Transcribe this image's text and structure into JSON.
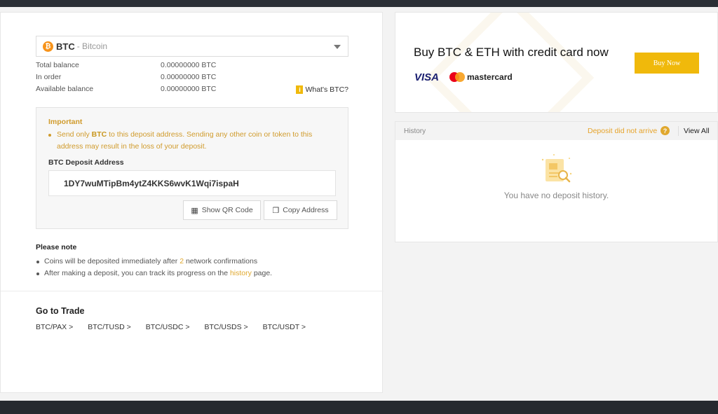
{
  "coin": {
    "symbol": "BTC",
    "name": "- Bitcoin",
    "icon": "bitcoin-icon"
  },
  "balances": [
    {
      "label": "Total balance",
      "value": "0.00000000 BTC"
    },
    {
      "label": "In order",
      "value": "0.00000000 BTC"
    },
    {
      "label": "Available balance",
      "value": "0.00000000 BTC"
    }
  ],
  "whats_btc": "What's BTC?",
  "important": {
    "title": "Important",
    "text_before": "Send only ",
    "text_coin": "BTC",
    "text_after": " to this deposit address. Sending any other coin or token to this address may result in the loss of your deposit."
  },
  "deposit": {
    "label": "BTC Deposit Address",
    "address": "1DY7wuMTipBm4ytZ4KKS6wvK1Wqi7ispaH",
    "show_qr_label": "Show QR Code",
    "copy_label": "Copy Address"
  },
  "note": {
    "title": "Please note",
    "item1_before": "Coins will be deposited immediately after ",
    "item1_count": "2",
    "item1_after": " network confirmations",
    "item2_before": "After making a deposit, you can track its progress on the ",
    "item2_link": "history",
    "item2_after": " page."
  },
  "trade": {
    "title": "Go to Trade",
    "pairs": [
      "BTC/PAX >",
      "BTC/TUSD >",
      "BTC/USDC >",
      "BTC/USDS >",
      "BTC/USDT >"
    ]
  },
  "promo": {
    "title": "Buy BTC & ETH with credit card now",
    "visa": "VISA",
    "mastercard": "mastercard",
    "button": "Buy Now"
  },
  "history": {
    "title": "History",
    "not_arrive": "Deposit did not arrive",
    "view_all": "View All",
    "empty": "You have no deposit history."
  },
  "colors": {
    "accent": "#f0b90b",
    "warning_text": "#d09b2c",
    "link": "#e0a82e"
  }
}
